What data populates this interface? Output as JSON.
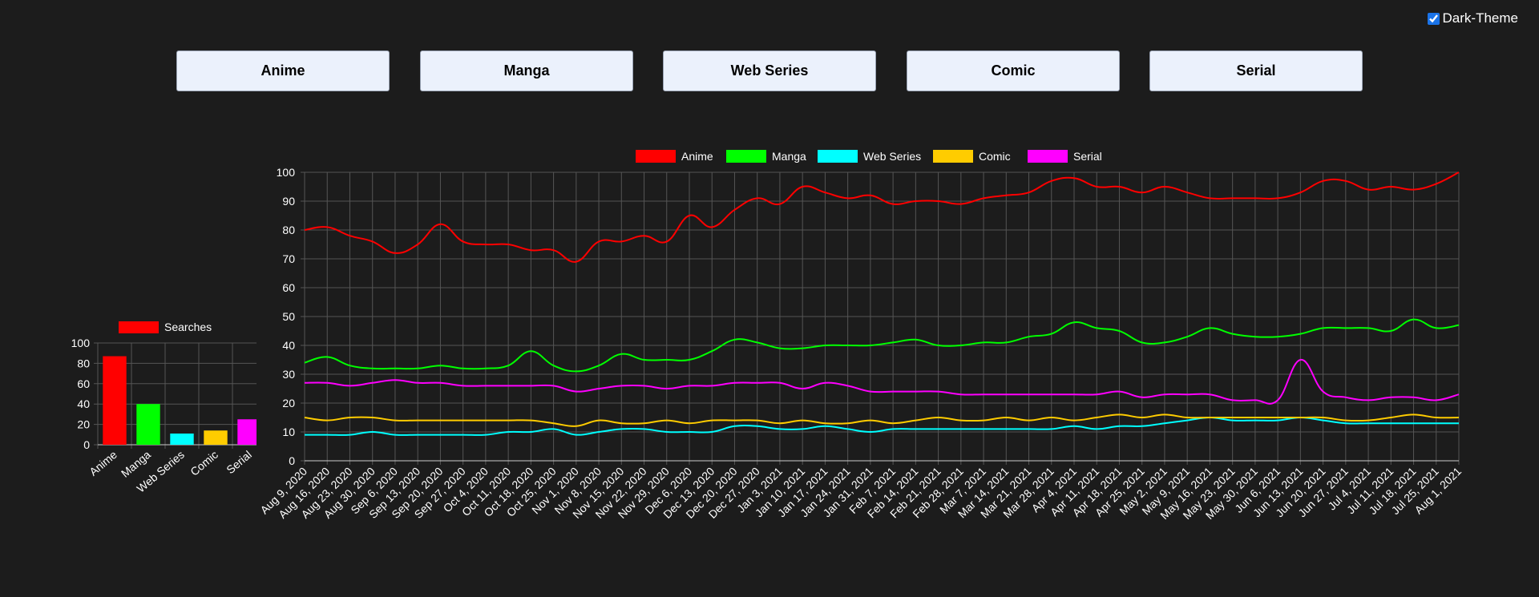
{
  "theme_toggle": {
    "label": "Dark-Theme",
    "checked": true
  },
  "nav": {
    "buttons": [
      {
        "label": "Anime"
      },
      {
        "label": "Manga"
      },
      {
        "label": "Web Series"
      },
      {
        "label": "Comic"
      },
      {
        "label": "Serial"
      }
    ]
  },
  "colors": {
    "background": "#1c1c1c",
    "grid": "#555555",
    "text": "#ffffff",
    "Anime": "#ff0000",
    "Manga": "#00ff00",
    "Web Series": "#00ffff",
    "Comic": "#ffcc00",
    "Serial": "#ff00ff"
  },
  "chart_data": [
    {
      "type": "bar",
      "categories": [
        "Anime",
        "Manga",
        "Web Series",
        "Comic",
        "Serial"
      ],
      "series": [
        {
          "name": "Searches",
          "values": [
            87,
            40,
            11,
            14,
            25
          ]
        }
      ],
      "bar_colors": [
        "#ff0000",
        "#00ff00",
        "#00ffff",
        "#ffcc00",
        "#ff00ff"
      ],
      "ylim": [
        0,
        100
      ],
      "yticks": [
        0,
        20,
        40,
        60,
        80,
        100
      ],
      "grid": true,
      "legend": "top"
    },
    {
      "type": "line",
      "x": [
        "Aug 9, 2020",
        "Aug 16, 2020",
        "Aug 23, 2020",
        "Aug 30, 2020",
        "Sep 6, 2020",
        "Sep 13, 2020",
        "Sep 20, 2020",
        "Sep 27, 2020",
        "Oct 4, 2020",
        "Oct 11, 2020",
        "Oct 18, 2020",
        "Oct 25, 2020",
        "Nov 1, 2020",
        "Nov 8, 2020",
        "Nov 15, 2020",
        "Nov 22, 2020",
        "Nov 29, 2020",
        "Dec 6, 2020",
        "Dec 13, 2020",
        "Dec 20, 2020",
        "Dec 27, 2020",
        "Jan 3, 2021",
        "Jan 10, 2021",
        "Jan 17, 2021",
        "Jan 24, 2021",
        "Jan 31, 2021",
        "Feb 7, 2021",
        "Feb 14, 2021",
        "Feb 21, 2021",
        "Feb 28, 2021",
        "Mar 7, 2021",
        "Mar 14, 2021",
        "Mar 21, 2021",
        "Mar 28, 2021",
        "Apr 4, 2021",
        "Apr 11, 2021",
        "Apr 18, 2021",
        "Apr 25, 2021",
        "May 2, 2021",
        "May 9, 2021",
        "May 16, 2021",
        "May 23, 2021",
        "May 30, 2021",
        "Jun 6, 2021",
        "Jun 13, 2021",
        "Jun 20, 2021",
        "Jun 27, 2021",
        "Jul 4, 2021",
        "Jul 11, 2021",
        "Jul 18, 2021",
        "Jul 25, 2021",
        "Aug 1, 2021"
      ],
      "series": [
        {
          "name": "Anime",
          "color": "#ff0000",
          "values": [
            80,
            81,
            78,
            76,
            72,
            75,
            82,
            76,
            75,
            75,
            73,
            73,
            69,
            76,
            76,
            78,
            76,
            85,
            81,
            87,
            91,
            89,
            95,
            93,
            91,
            92,
            89,
            90,
            90,
            89,
            91,
            92,
            93,
            97,
            98,
            95,
            95,
            93,
            95,
            93,
            91,
            91,
            91,
            91,
            93,
            97,
            97,
            94,
            95,
            94,
            96,
            100
          ]
        },
        {
          "name": "Manga",
          "color": "#00ff00",
          "values": [
            34,
            36,
            33,
            32,
            32,
            32,
            33,
            32,
            32,
            33,
            38,
            33,
            31,
            33,
            37,
            35,
            35,
            35,
            38,
            42,
            41,
            39,
            39,
            40,
            40,
            40,
            41,
            42,
            40,
            40,
            41,
            41,
            43,
            44,
            48,
            46,
            45,
            41,
            41,
            43,
            46,
            44,
            43,
            43,
            44,
            46,
            46,
            46,
            45,
            49,
            46,
            47
          ]
        },
        {
          "name": "Web Series",
          "color": "#00ffff",
          "values": [
            9,
            9,
            9,
            10,
            9,
            9,
            9,
            9,
            9,
            10,
            10,
            11,
            9,
            10,
            11,
            11,
            10,
            10,
            10,
            12,
            12,
            11,
            11,
            12,
            11,
            10,
            11,
            11,
            11,
            11,
            11,
            11,
            11,
            11,
            12,
            11,
            12,
            12,
            13,
            14,
            15,
            14,
            14,
            14,
            15,
            14,
            13,
            13,
            13,
            13,
            13,
            13
          ]
        },
        {
          "name": "Comic",
          "color": "#ffcc00",
          "values": [
            15,
            14,
            15,
            15,
            14,
            14,
            14,
            14,
            14,
            14,
            14,
            13,
            12,
            14,
            13,
            13,
            14,
            13,
            14,
            14,
            14,
            13,
            14,
            13,
            13,
            14,
            13,
            14,
            15,
            14,
            14,
            15,
            14,
            15,
            14,
            15,
            16,
            15,
            16,
            15,
            15,
            15,
            15,
            15,
            15,
            15,
            14,
            14,
            15,
            16,
            15,
            15
          ]
        },
        {
          "name": "Serial",
          "color": "#ff00ff",
          "values": [
            27,
            27,
            26,
            27,
            28,
            27,
            27,
            26,
            26,
            26,
            26,
            26,
            24,
            25,
            26,
            26,
            25,
            26,
            26,
            27,
            27,
            27,
            25,
            27,
            26,
            24,
            24,
            24,
            24,
            23,
            23,
            23,
            23,
            23,
            23,
            23,
            24,
            22,
            23,
            23,
            23,
            21,
            21,
            21,
            35,
            24,
            22,
            21,
            22,
            22,
            21,
            23
          ]
        }
      ],
      "ylim": [
        0,
        100
      ],
      "yticks": [
        0,
        10,
        20,
        30,
        40,
        50,
        60,
        70,
        80,
        90,
        100
      ],
      "grid": true,
      "legend": "top"
    }
  ]
}
